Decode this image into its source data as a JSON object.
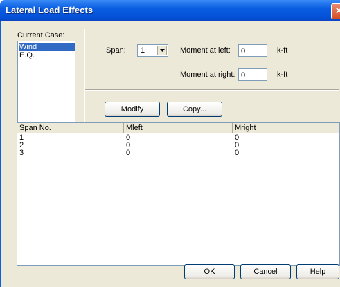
{
  "window": {
    "title": "Lateral Load Effects",
    "close_symbol": "✕"
  },
  "current_case": {
    "label": "Current Case:",
    "items": [
      "Wind",
      "E.Q."
    ],
    "selected": "Wind"
  },
  "span": {
    "label": "Span:",
    "value": "1"
  },
  "moment_left": {
    "label": "Moment at left:",
    "value": "0",
    "unit": "k-ft"
  },
  "moment_right": {
    "label": "Moment at right:",
    "value": "0",
    "unit": "k-ft"
  },
  "buttons": {
    "modify": "Modify",
    "copy": "Copy...",
    "ok": "OK",
    "cancel": "Cancel",
    "help": "Help"
  },
  "table": {
    "columns": [
      "Span No.",
      "Mleft",
      "Mright"
    ],
    "rows": [
      [
        "1",
        "0",
        "0"
      ],
      [
        "2",
        "0",
        "0"
      ],
      [
        "3",
        "0",
        "0"
      ]
    ]
  },
  "colors": {
    "title_bar": "#0a5ee2",
    "dialog_bg": "#ece9d8",
    "selection": "#316ac5",
    "close_button": "#d34f26"
  }
}
